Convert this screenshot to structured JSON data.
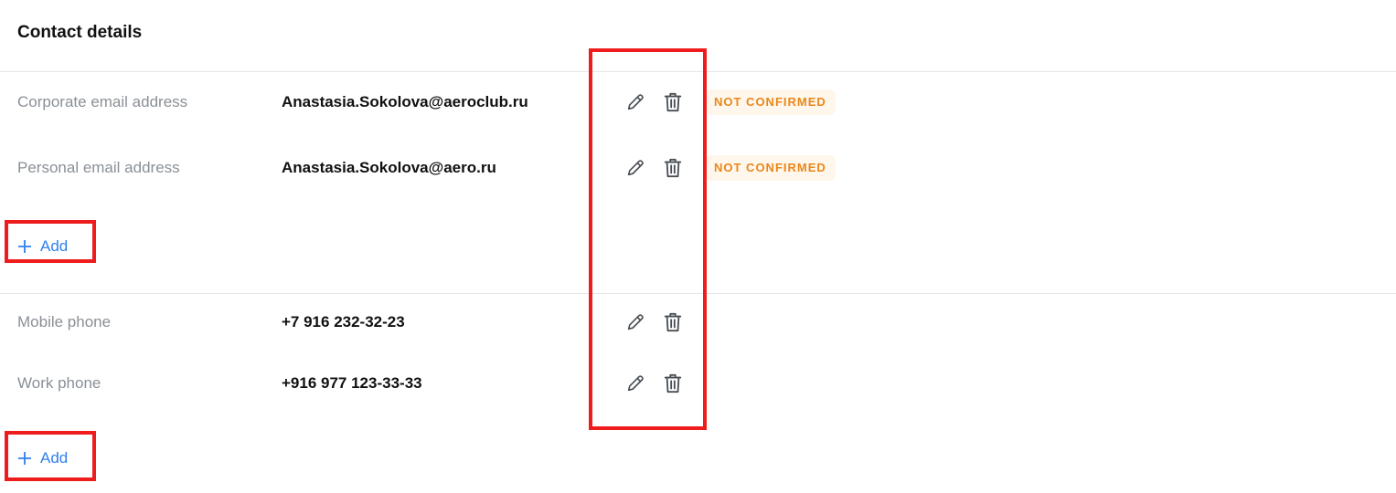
{
  "title": "Contact details",
  "email_section": {
    "rows": [
      {
        "label": "Corporate email address",
        "value": "Anastasia.Sokolova@aeroclub.ru",
        "status": "NOT CONFIRMED"
      },
      {
        "label": "Personal email address",
        "value": "Anastasia.Sokolova@aero.ru",
        "status": "NOT CONFIRMED"
      }
    ],
    "add_label": "Add"
  },
  "phone_section": {
    "rows": [
      {
        "label": "Mobile phone",
        "value": "+7 916 232-32-23"
      },
      {
        "label": "Work phone",
        "value": "+916 977 123-33-33"
      }
    ],
    "add_label": "Add"
  },
  "icons": {
    "edit": "pencil-icon",
    "delete": "trash-icon",
    "add": "plus-icon"
  },
  "colors": {
    "accent": "#2f80ed",
    "status_text": "#e8881a",
    "status_bg": "#fff6ec",
    "highlight": "#ee1c1c"
  }
}
